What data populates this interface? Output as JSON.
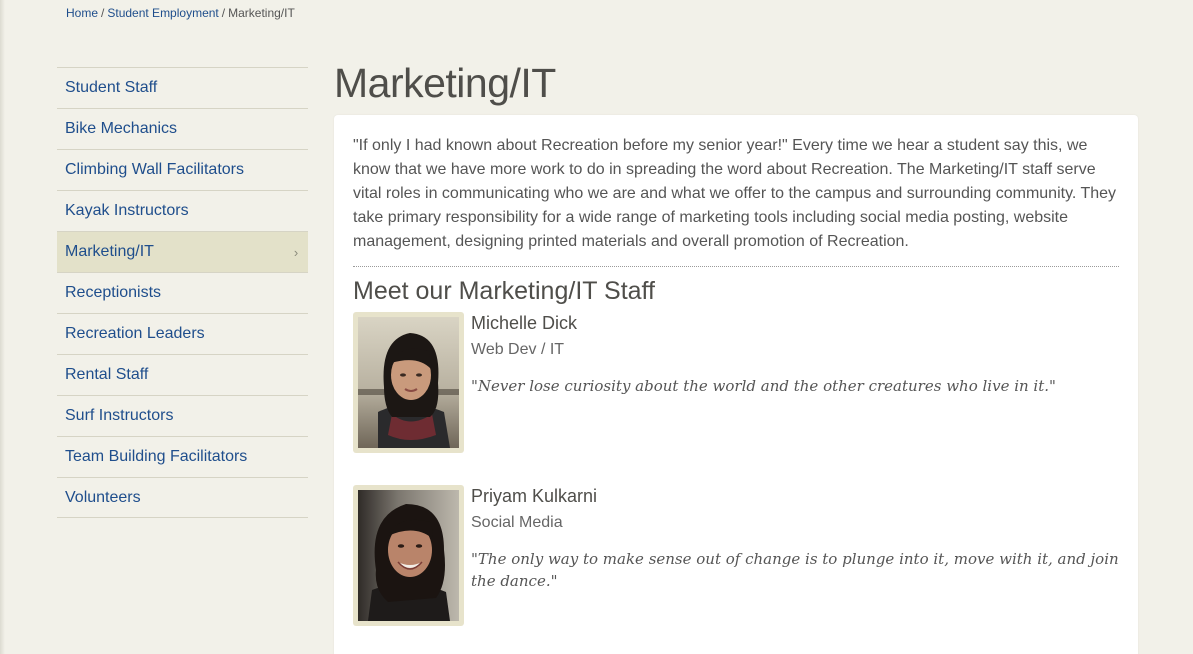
{
  "breadcrumb": {
    "home": "Home",
    "separator": "/",
    "parent": "Student Employment",
    "current": "Marketing/IT"
  },
  "sidebar": {
    "items": [
      {
        "label": "Student Staff"
      },
      {
        "label": "Bike Mechanics"
      },
      {
        "label": "Climbing Wall Facilitators"
      },
      {
        "label": "Kayak Instructors"
      },
      {
        "label": "Marketing/IT",
        "active": true,
        "chevron": "›"
      },
      {
        "label": "Receptionists"
      },
      {
        "label": "Recreation Leaders"
      },
      {
        "label": "Rental Staff"
      },
      {
        "label": "Surf Instructors"
      },
      {
        "label": "Team Building Facilitators"
      },
      {
        "label": "Volunteers"
      }
    ]
  },
  "page": {
    "title": "Marketing/IT",
    "intro": "\"If only I had known about Recreation before my senior year!\" Every time we hear a student say this, we know that we have more work to do in spreading the word about Recreation. The Marketing/IT staff serve vital roles in communicating who we are and what we offer to the campus and surrounding community. They take primary responsibility for a wide range of marketing tools including social media posting, website management, designing printed materials and overall promotion of Recreation.",
    "staff_heading": "Meet our Marketing/IT Staff"
  },
  "staff": [
    {
      "name": "Michelle Dick",
      "role": "Web Dev / IT",
      "quote": "\"Never lose curiosity about the world and the other creatures who live in it.\""
    },
    {
      "name": "Priyam Kulkarni",
      "role": "Social Media",
      "quote": "\"The only way to make sense out of change is to plunge into it, move with it, and join the dance.\""
    }
  ],
  "colors": {
    "link": "#1f4e8c",
    "background": "#f2f1e9",
    "active_item": "#e3e1c9",
    "photo_frame": "#e7e3cb"
  }
}
